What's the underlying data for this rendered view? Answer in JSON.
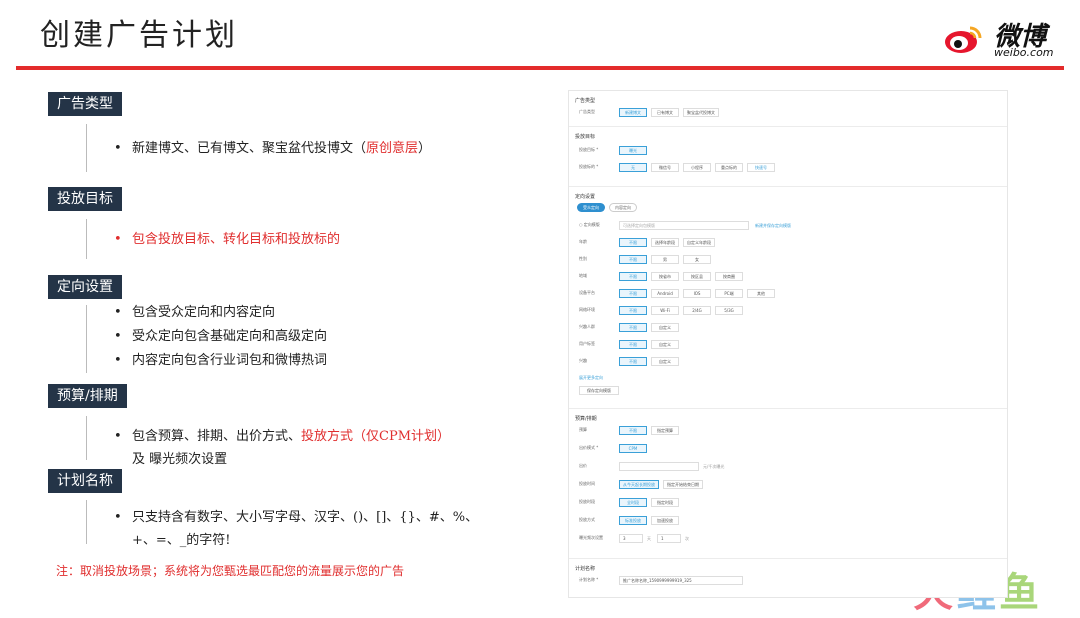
{
  "page": {
    "title": "创建广告计划"
  },
  "logo": {
    "brand": "微博",
    "domain": "weibo.com"
  },
  "sections": [
    {
      "tag": "广告类型",
      "bullets": [
        {
          "segments": [
            {
              "text": "新建博文、已有博文、聚宝盆代投博文（",
              "red": false
            },
            {
              "text": "原创意层",
              "red": true
            },
            {
              "text": "）",
              "red": false
            }
          ]
        }
      ]
    },
    {
      "tag": "投放目标",
      "bullets": [
        {
          "segments": [
            {
              "text": "包含投放目标、转化目标和投放标的",
              "red": true
            }
          ],
          "red_dot": true
        }
      ]
    },
    {
      "tag": "定向设置",
      "bullets": [
        {
          "segments": [
            {
              "text": "包含受众定向和内容定向",
              "red": false
            }
          ]
        },
        {
          "segments": [
            {
              "text": "受众定向包含基础定向和高级定向",
              "red": false
            }
          ]
        },
        {
          "segments": [
            {
              "text": "内容定向包含行业词包和微博热词",
              "red": false
            }
          ]
        }
      ]
    },
    {
      "tag": "预算/排期",
      "bullets": [
        {
          "segments": [
            {
              "text": "包含预算、排期、出价方式、",
              "red": false
            },
            {
              "text": "投放方式（仅CPM计划）",
              "red": true
            }
          ],
          "cont": "及 曝光频次设置"
        }
      ]
    },
    {
      "tag": "计划名称",
      "bullets": [
        {
          "segments": [
            {
              "text": "只支持含有数字、大小写字母、汉字、()、[]、{}、#、%、",
              "red": false
            }
          ],
          "cont": "+、=、_的字符!"
        }
      ]
    }
  ],
  "note": "注：取消投放场景；系统将为您甄选最匹配您的流量展示您的广告",
  "watermark": {
    "a": "火",
    "b": "鲤",
    "c": "鱼"
  },
  "form": {
    "block1": {
      "title": "广告类型",
      "rows": [
        {
          "label": "广告类型",
          "options": [
            "新建博文",
            "已有博文",
            "聚宝盆代投博文"
          ],
          "selected": 0
        }
      ]
    },
    "block2": {
      "title": "投放目标",
      "rows": [
        {
          "label": "投放目标 *",
          "options": [
            "曝光"
          ],
          "selected": 0
        },
        {
          "label": "投放标的 *",
          "options": [
            "无",
            "微信号",
            "小程序",
            "重点标的",
            "快速号"
          ],
          "selected": 0
        }
      ]
    },
    "block3": {
      "title": "定向设置",
      "pills": [
        "受众定向",
        "内容定向"
      ],
      "select_placeholder": "可选择定向包模版",
      "select_link": "新建并保存定向模版",
      "rows": [
        {
          "label": "年龄",
          "options": [
            "不限",
            "选择年龄段",
            "自定义年龄段"
          ],
          "selected": 0
        },
        {
          "label": "性别",
          "options": [
            "不限",
            "男",
            "女"
          ],
          "selected": 0
        },
        {
          "label": "地域",
          "options": [
            "不限",
            "按省市",
            "按区县",
            "按商圈"
          ],
          "selected": 0
        },
        {
          "label": "设备平台",
          "options": [
            "不限",
            "Android",
            "IOS",
            "PC端",
            "其他"
          ],
          "selected": 0
        },
        {
          "label": "网络环境",
          "options": [
            "不限",
            "Wi-Fi",
            "2/4G",
            "5/3G"
          ],
          "selected": 0
        },
        {
          "label": "兴趣人群",
          "options": [
            "不限",
            "自定义"
          ],
          "selected": 0
        },
        {
          "label": "用户标签",
          "options": [
            "不限",
            "自定义"
          ],
          "selected": 0
        },
        {
          "label": "兴趣",
          "options": [
            "不限",
            "自定义"
          ],
          "selected": 0
        }
      ],
      "more_link": "展开更多定向",
      "save_button": "保存定向模版"
    },
    "block4": {
      "title": "预算/排期",
      "rows": [
        {
          "label": "预算",
          "options": [
            "不限",
            "指定预算"
          ],
          "selected": 0
        },
        {
          "label": "出价模式 *",
          "options": [
            "CPM"
          ],
          "selected": 0
        },
        {
          "label": "出价",
          "input": "",
          "suffix": "元/千次曝光"
        },
        {
          "label": "投放时间",
          "options": [
            "从今天起长期投放",
            "指定开始结束日期"
          ],
          "selected": 0
        },
        {
          "label": "投放时段",
          "options": [
            "全时段",
            "指定时段"
          ],
          "selected": 0
        },
        {
          "label": "投放方式",
          "options": [
            "标准投放",
            "加速投放"
          ],
          "selected": 0
        },
        {
          "label": "曝光频次设置",
          "freq": [
            "3",
            "天",
            "1",
            "次"
          ]
        }
      ]
    },
    "block5": {
      "title": "计划名称",
      "rows": [
        {
          "label": "计划名称 *",
          "input": "推广名称名称_1590999999919_325"
        }
      ]
    }
  }
}
